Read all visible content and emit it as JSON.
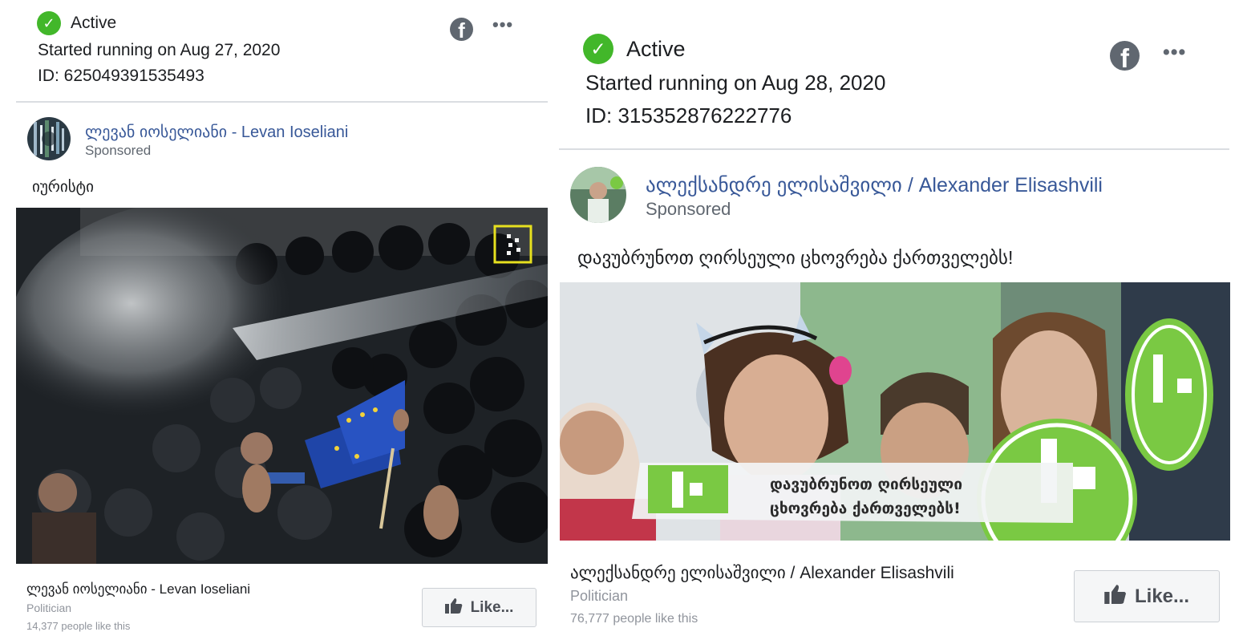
{
  "ads": [
    {
      "status": "Active",
      "started": "Started running on Aug 27, 2020",
      "id_text": "ID: 625049391535493",
      "page_name": "ლევან იოსელიანი - Levan Ioseliani",
      "sponsored": "Sponsored",
      "body_text": "იურისტი",
      "footer_name": "ლევან იოსელიანი - Levan Ioseliani",
      "footer_category": "Politician",
      "footer_likes": "14,377 people like this",
      "like_label": "Like..."
    },
    {
      "status": "Active",
      "started": "Started running on Aug 28, 2020",
      "id_text": "ID: 315352876222776",
      "page_name": "ალექსანდრე ელისაშვილი / Alexander Elisashvili",
      "sponsored": "Sponsored",
      "body_text": "დავუბრუნოთ ღირსეული ცხოვრება ქართველებს!",
      "banner_line1": "დავუბრუნოთ ღირსეული",
      "banner_line2": "ცხოვრება ქართველებს!",
      "footer_name": "ალექსანდრე ელისაშვილი / Alexander Elisashvili",
      "footer_category": "Politician",
      "footer_likes": "76,777 people like this",
      "like_label": "Like..."
    }
  ],
  "icons": {
    "status": "check-circle-icon",
    "platform": "facebook-icon",
    "menu": "more-options-icon",
    "like": "thumbs-up-icon"
  },
  "colors": {
    "active_green": "#42b72a",
    "link_blue": "#385898",
    "meta_gray": "#606770",
    "divider": "#dadde1",
    "logo_green": "#7ac943"
  }
}
